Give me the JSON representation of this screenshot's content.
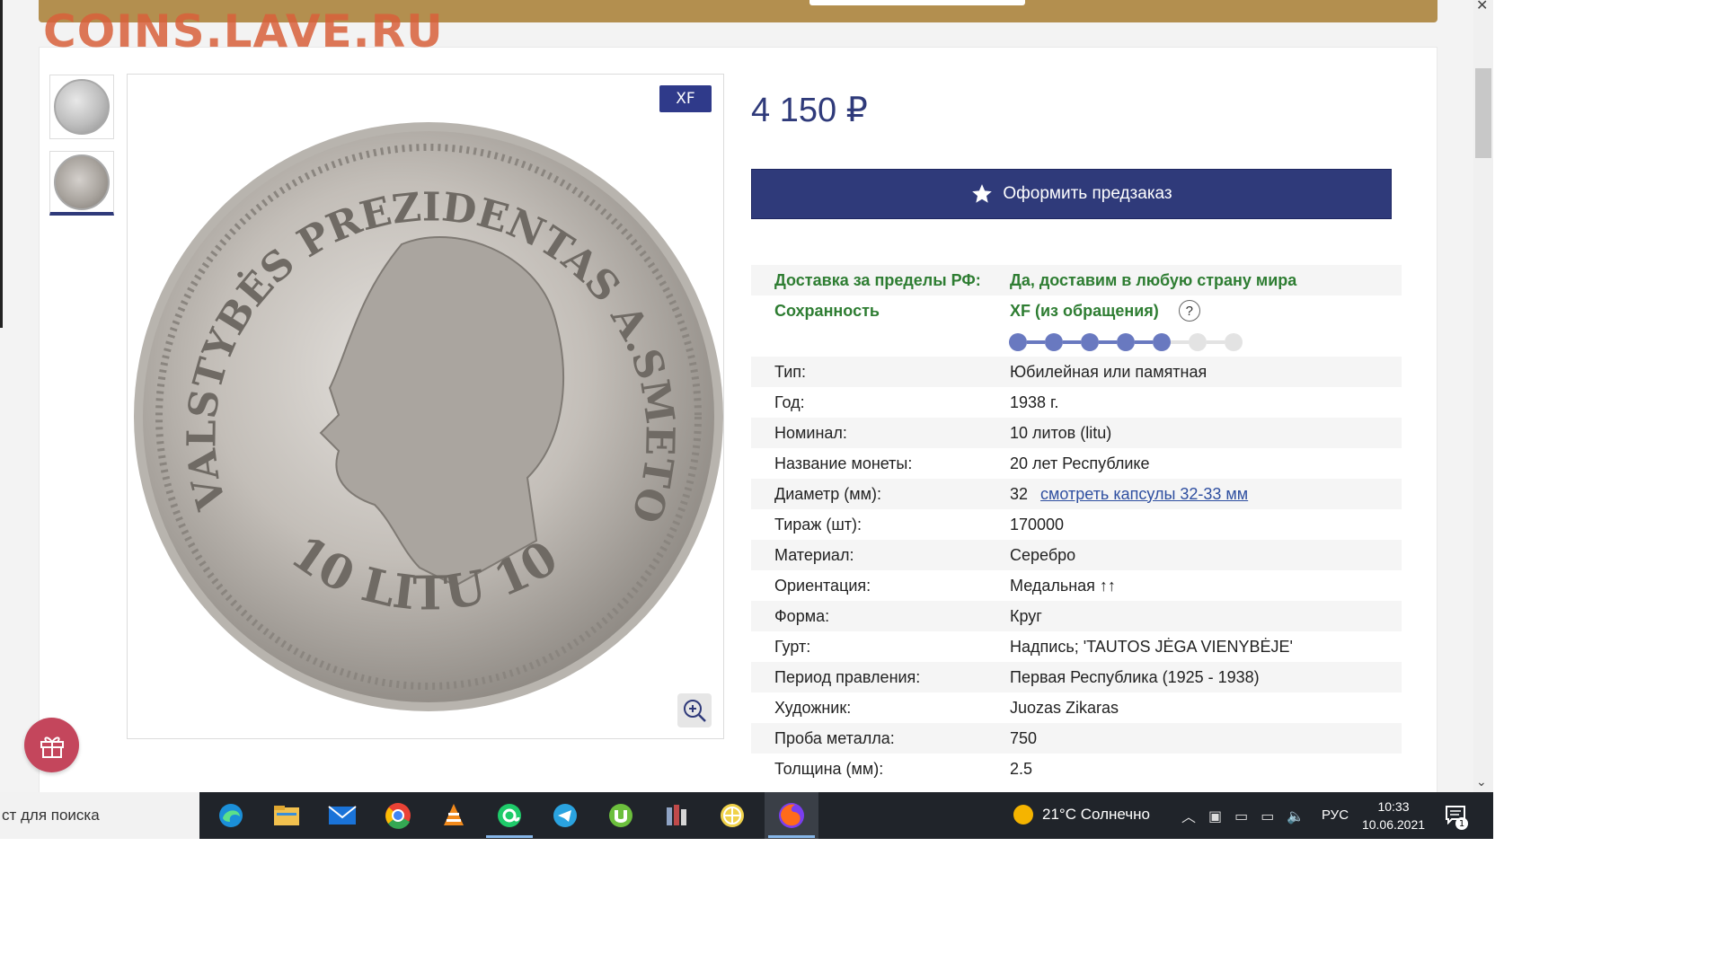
{
  "site": {
    "watermark": "COINS.LAVE.RU"
  },
  "product": {
    "grade_badge": "XF",
    "price": "4 150 ₽",
    "preorder_label": "Оформить предзаказ",
    "condition_level": 5,
    "condition_max": 7
  },
  "specs": {
    "delivery_label": "Доставка за пределы РФ:",
    "delivery_value": "Да, доставим в любую страну мира",
    "condition_label": "Сохранность",
    "condition_value": "XF (из обращения)",
    "help_mark": "?",
    "rows": [
      {
        "label": "Тип:",
        "value": "Юбилейная или памятная"
      },
      {
        "label": "Год:",
        "value": "1938 г."
      },
      {
        "label": "Номинал:",
        "value": "10 литов (litu)"
      },
      {
        "label": "Название монеты:",
        "value": "20 лет Республике"
      },
      {
        "label": "Диаметр (мм):",
        "value": "32",
        "link": "смотреть капсулы 32-33 мм"
      },
      {
        "label": "Тираж (шт):",
        "value": "170000"
      },
      {
        "label": "Материал:",
        "value": "Серебро"
      },
      {
        "label": "Ориентация:",
        "value": "Медальная ↑↑"
      },
      {
        "label": "Форма:",
        "value": "Круг"
      },
      {
        "label": "Гурт:",
        "value": "Надпись; 'TAUTOS JĖGA VIENYBĖJE'"
      },
      {
        "label": "Период правления:",
        "value": "Первая Республика (1925 - 1938)"
      },
      {
        "label": "Художник:",
        "value": "Juozas Zikaras"
      },
      {
        "label": "Проба металла:",
        "value": "750"
      },
      {
        "label": "Толщина (мм):",
        "value": "2.5"
      }
    ]
  },
  "coin": {
    "legend_top": "VALSTYBĖS PREZIDENTAS A.SMETONA",
    "legend_bottom": "10 LITU 10"
  },
  "taskbar": {
    "search_text": "ст для поиска",
    "weather": "21°C  Солнечно",
    "lang": "РУС",
    "time": "10:33",
    "date": "10.06.2021",
    "notif_count": "1"
  },
  "colors": {
    "brand_blue": "#2f3a7a",
    "banner": "#b38f4f",
    "green": "#2e7d32",
    "gift": "#c4465c"
  }
}
